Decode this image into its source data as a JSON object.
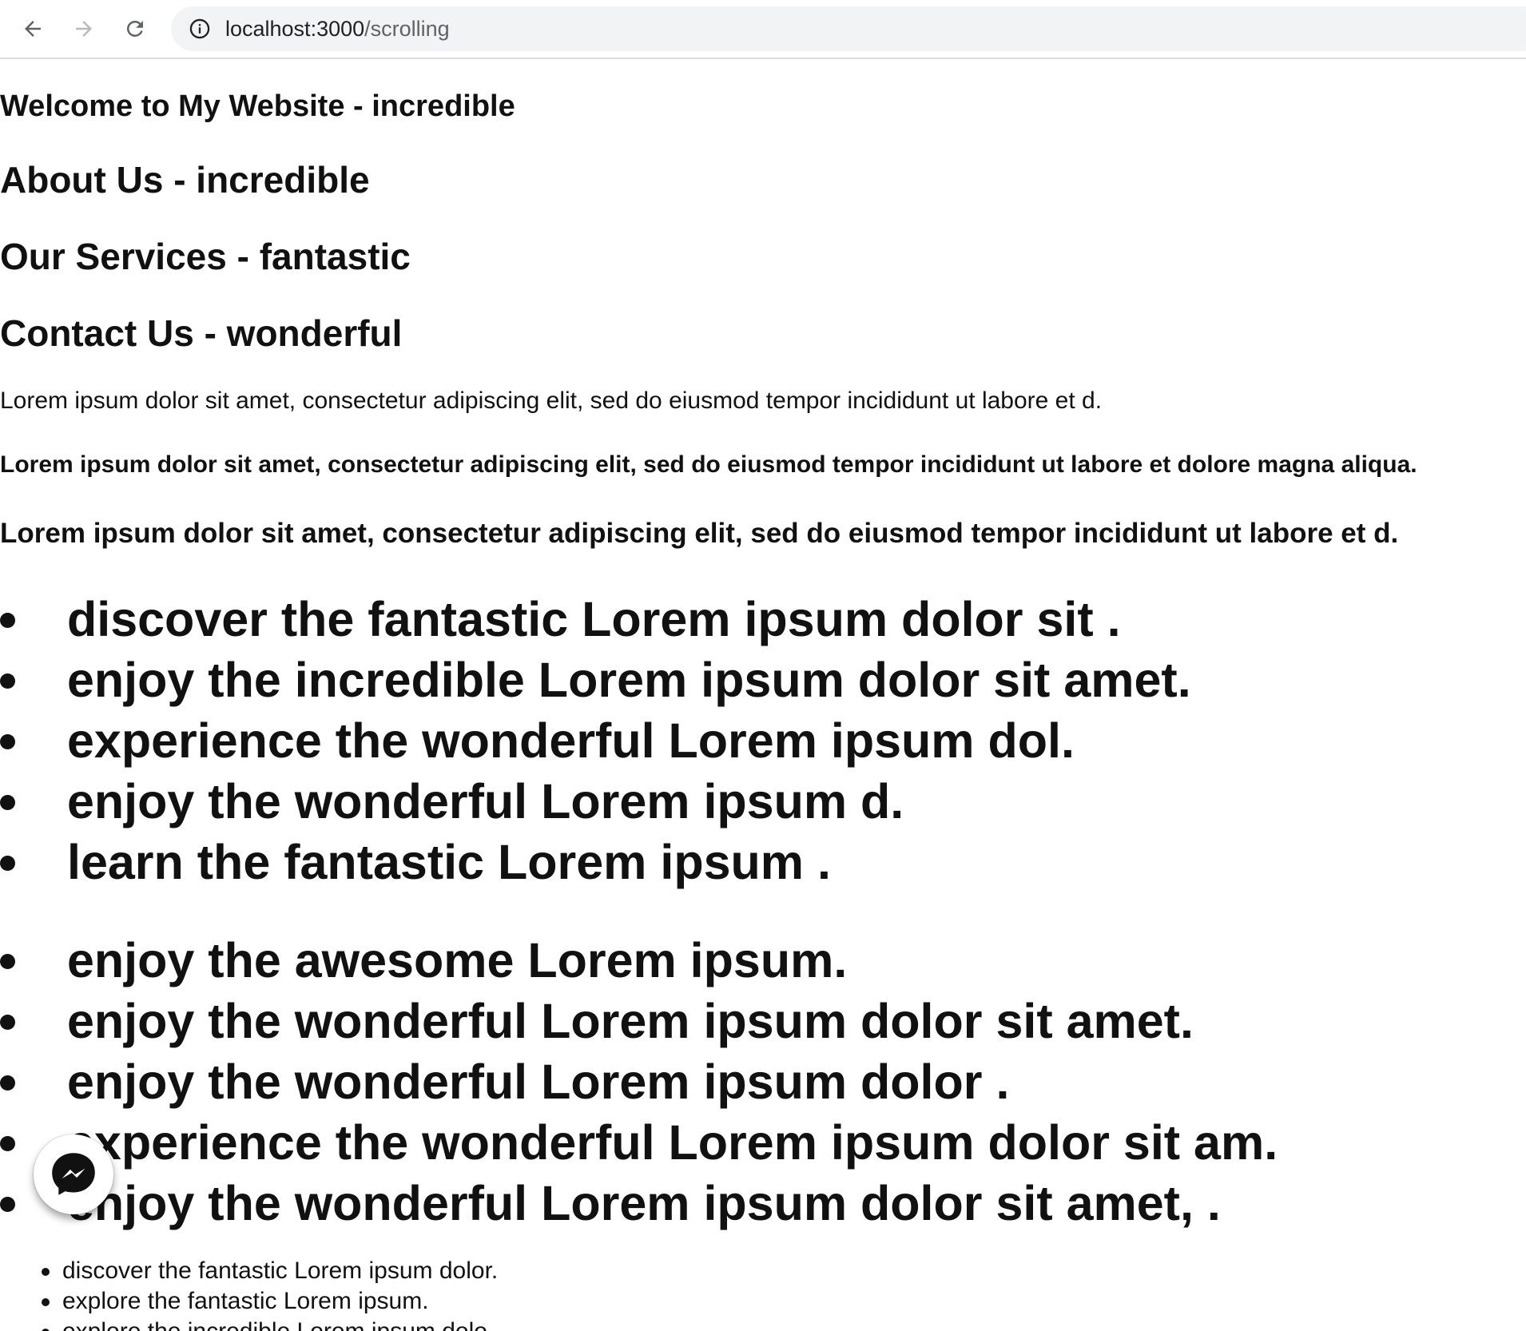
{
  "browser": {
    "url_host": "localhost:3000",
    "url_path": "/scrolling",
    "icons": [
      "back-icon",
      "forward-icon",
      "reload-icon",
      "info-icon"
    ]
  },
  "page": {
    "title": "Welcome to My Website - incredible",
    "sections": [
      "About Us - incredible",
      "Our Services - fantastic",
      "Contact Us - wonderful"
    ],
    "paragraphs": [
      "Lorem ipsum dolor sit amet, consectetur adipiscing elit, sed do eiusmod tempor incididunt ut labore et d.",
      "Lorem ipsum dolor sit amet, consectetur adipiscing elit, sed do eiusmod tempor incididunt ut labore et dolore magna aliqua.",
      "Lorem ipsum dolor sit amet, consectetur adipiscing elit, sed do eiusmod tempor incididunt ut labore et d."
    ],
    "list1": [
      "discover the fantastic Lorem ipsum dolor sit .",
      "enjoy the incredible Lorem ipsum dolor sit amet.",
      "experience the wonderful Lorem ipsum dol.",
      "enjoy the wonderful Lorem ipsum d.",
      "learn the fantastic Lorem ipsum ."
    ],
    "list2": [
      "enjoy the awesome Lorem ipsum.",
      "enjoy the wonderful Lorem ipsum dolor sit amet.",
      "enjoy the wonderful Lorem ipsum dolor .",
      "experience the wonderful Lorem ipsum dolor sit am.",
      "enjoy the wonderful Lorem ipsum dolor sit amet, ."
    ],
    "list3": [
      "discover the fantastic Lorem ipsum dolor.",
      "explore the fantastic Lorem ipsum.",
      "explore the incredible Lorem ipsum dolo."
    ]
  },
  "floating_button": {
    "icon": "messenger-icon"
  }
}
